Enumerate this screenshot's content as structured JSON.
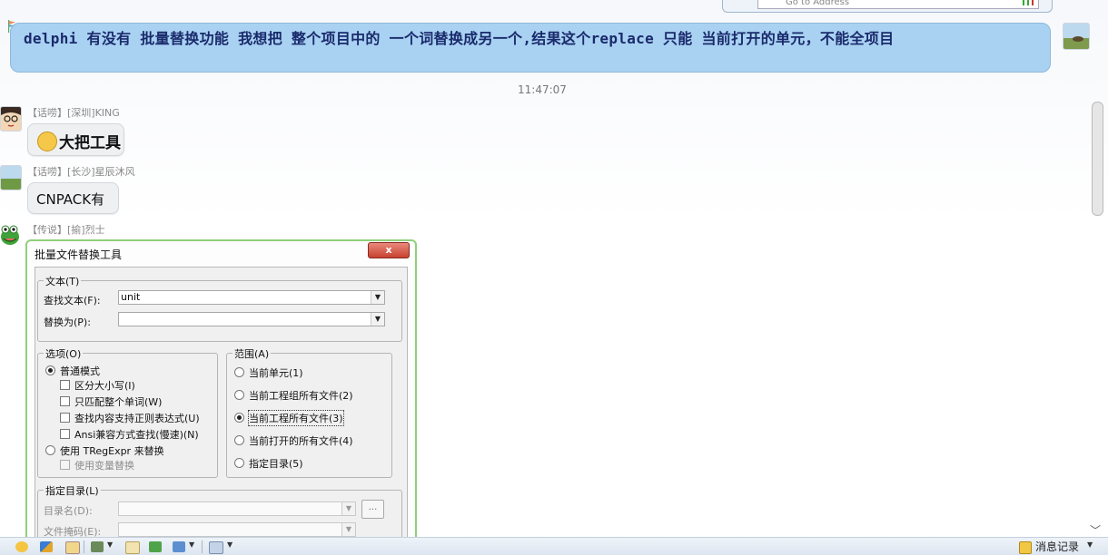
{
  "top_strip": {
    "address_placeholder": "Go to Address",
    "icon_label": "|信"
  },
  "question": {
    "text": "delphi 有没有 批量替换功能 我想把 整个项目中的 一个词替换成另一个,结果这个replace 只能 当前打开的单元，不能全项目"
  },
  "timestamp": "11:47:07",
  "messages": [
    {
      "sender": "【话唠】[深圳]KING",
      "text": "大把工具",
      "emoticon": "wink-smiley"
    },
    {
      "sender": "【话唠】[长沙]星辰沐风",
      "text": "CNPACK有"
    },
    {
      "sender": "【传说】[揄]烈士"
    }
  ],
  "dialog": {
    "title": "批量文件替换工具",
    "close_label": "x",
    "text_group": {
      "legend": "文本(T)",
      "find_label": "查找文本(F):",
      "find_value": "unit",
      "replace_label": "替换为(P):",
      "replace_value": ""
    },
    "options_group": {
      "legend": "选项(O)",
      "normal_mode": "普通模式",
      "case_sensitive": "区分大小写(I)",
      "whole_word": "只匹配整个单词(W)",
      "regex": "查找内容支持正则表达式(U)",
      "ansi": "Ansi兼容方式查找(慢速)(N)",
      "tregexpr": "使用 TRegExpr 来替换",
      "use_vars": "使用变量替换"
    },
    "scope_group": {
      "legend": "范围(A)",
      "items": [
        "当前单元(1)",
        "当前工程组所有文件(2)",
        "当前工程所有文件(3)",
        "当前打开的所有文件(4)",
        "指定目录(5)"
      ],
      "selected_index": 2
    },
    "directory_group": {
      "legend": "指定目录(L)",
      "dir_label": "目录名(D):",
      "mask_label": "文件掩码(E):",
      "browse_label": "..."
    }
  },
  "toolbar": {
    "history_label": "消息记录"
  },
  "colors": {
    "question_bubble": "#a9d2f2",
    "question_text": "#1a2a6c",
    "image_card_border": "#8fd07a",
    "close_button": "#c7412f"
  }
}
